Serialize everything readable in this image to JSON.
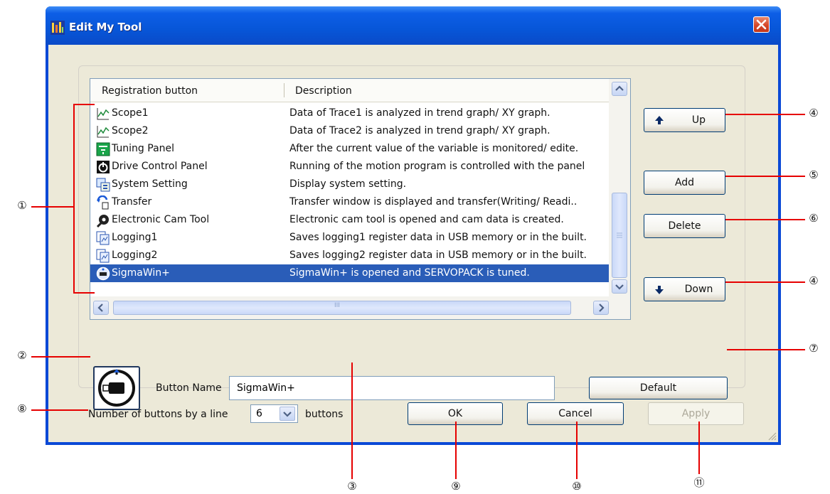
{
  "window": {
    "title": "Edit My Tool"
  },
  "list": {
    "columns": [
      "Registration button",
      "Description"
    ],
    "rows": [
      {
        "name": "Scope1",
        "icon": "scope-icon",
        "description": "Data of Trace1 is analyzed in trend graph/ XY graph."
      },
      {
        "name": "Scope2",
        "icon": "scope-icon",
        "description": "Data of Trace2 is analyzed in trend graph/ XY graph."
      },
      {
        "name": "Tuning Panel",
        "icon": "tuning-panel-icon",
        "description": "After the current value of the variable is monitored/ edite."
      },
      {
        "name": "Drive Control Panel",
        "icon": "drive-control-icon",
        "description": "Running of the motion program is controlled with the panel"
      },
      {
        "name": "System Setting",
        "icon": "system-setting-icon",
        "description": "Display system setting."
      },
      {
        "name": "Transfer",
        "icon": "transfer-icon",
        "description": "Transfer window is displayed and transfer(Writing/ Readi.."
      },
      {
        "name": "Electronic Cam Tool",
        "icon": "cam-tool-icon",
        "description": "Electronic cam tool is opened and cam data is created."
      },
      {
        "name": "Logging1",
        "icon": "logging-icon",
        "description": "Saves logging1 register data in USB memory or in the built."
      },
      {
        "name": "Logging2",
        "icon": "logging-icon",
        "description": "Saves logging2 register data in USB memory or in the built."
      },
      {
        "name": "SigmaWin+",
        "icon": "sigmawin-icon",
        "description": "SigmaWin+ is opened and SERVOPACK is tuned.",
        "selected": true
      }
    ],
    "hscroll_grip": "III"
  },
  "buttons": {
    "up": "Up",
    "add": "Add",
    "delete": "Delete",
    "down": "Down",
    "default": "Default",
    "ok": "OK",
    "cancel": "Cancel",
    "apply": "Apply"
  },
  "button_name": {
    "label": "Button Name",
    "value": "SigmaWin+"
  },
  "buttons_per_line": {
    "label": "Number of buttons by a line",
    "value": "6",
    "suffix": "buttons"
  },
  "callouts": [
    "①",
    "②",
    "③",
    "④",
    "⑤",
    "⑥",
    "④",
    "⑦",
    "⑧",
    "⑨",
    "⑩",
    "⑪"
  ],
  "colors": {
    "title_bar": "#0a49d6",
    "selection": "#2a5db8",
    "callout_line": "#e60000",
    "dialog_bg": "#ece9d8"
  }
}
